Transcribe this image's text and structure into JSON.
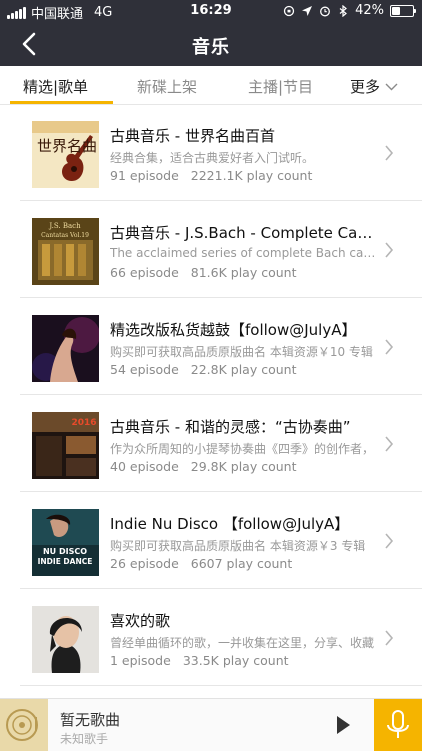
{
  "status": {
    "carrier": "中国联通",
    "network": "4G",
    "time": "16:29",
    "battery": "42%",
    "battery_level": 0.42
  },
  "nav": {
    "title": "音乐"
  },
  "tabs": [
    {
      "label": "精选|歌单",
      "active": true
    },
    {
      "label": "新碟上架",
      "active": false
    },
    {
      "label": "主播|节目",
      "active": false
    }
  ],
  "tabs_more": "更多",
  "items": [
    {
      "title": "古典音乐 - 世界名曲百首",
      "desc": "经典合集，适合古典爱好者入门试听。",
      "episodes": "91 episode",
      "plays": "2221.1K play count"
    },
    {
      "title": "古典音乐 - J.S.Bach - Complete Cantatas",
      "desc": "The acclaimed series of complete Bach cantatas",
      "episodes": "66 episode",
      "plays": "81.6K play count"
    },
    {
      "title": "精选改版私货越鼓【follow@JulyA】",
      "desc": "购买即可获取高品质原版曲名 本辑资源￥10 专辑",
      "episodes": "54 episode",
      "plays": "22.8K play count"
    },
    {
      "title": "古典音乐 - 和谐的灵感：“古协奏曲”",
      "desc": "作为众所周知的小提琴协奏曲《四季》的创作者，",
      "episodes": "40 episode",
      "plays": "29.8K play count"
    },
    {
      "title": "Indie Nu Disco 【follow@JulyA】",
      "desc": "购买即可获取高品质原版曲名 本辑资源￥3 专辑",
      "episodes": "26 episode",
      "plays": "6607 play count"
    },
    {
      "title": "喜欢的歌",
      "desc": "曾经单曲循环的歌，一并收集在这里，分享、收藏",
      "episodes": "1 episode",
      "plays": "33.5K play count"
    }
  ],
  "covers": {
    "cover1_text": "世界名曲",
    "cover2_top": "J.S. Bach",
    "cover2_mid": "Cantatas Vol.19",
    "cover4_top": "2016",
    "cover5_line1": "NU DISCO",
    "cover5_line2": "INDIE DANCE"
  },
  "player": {
    "song": "暂无歌曲",
    "singer": "未知歌手"
  },
  "colors": {
    "bar": "#2f3039",
    "accent": "#f5b400"
  }
}
